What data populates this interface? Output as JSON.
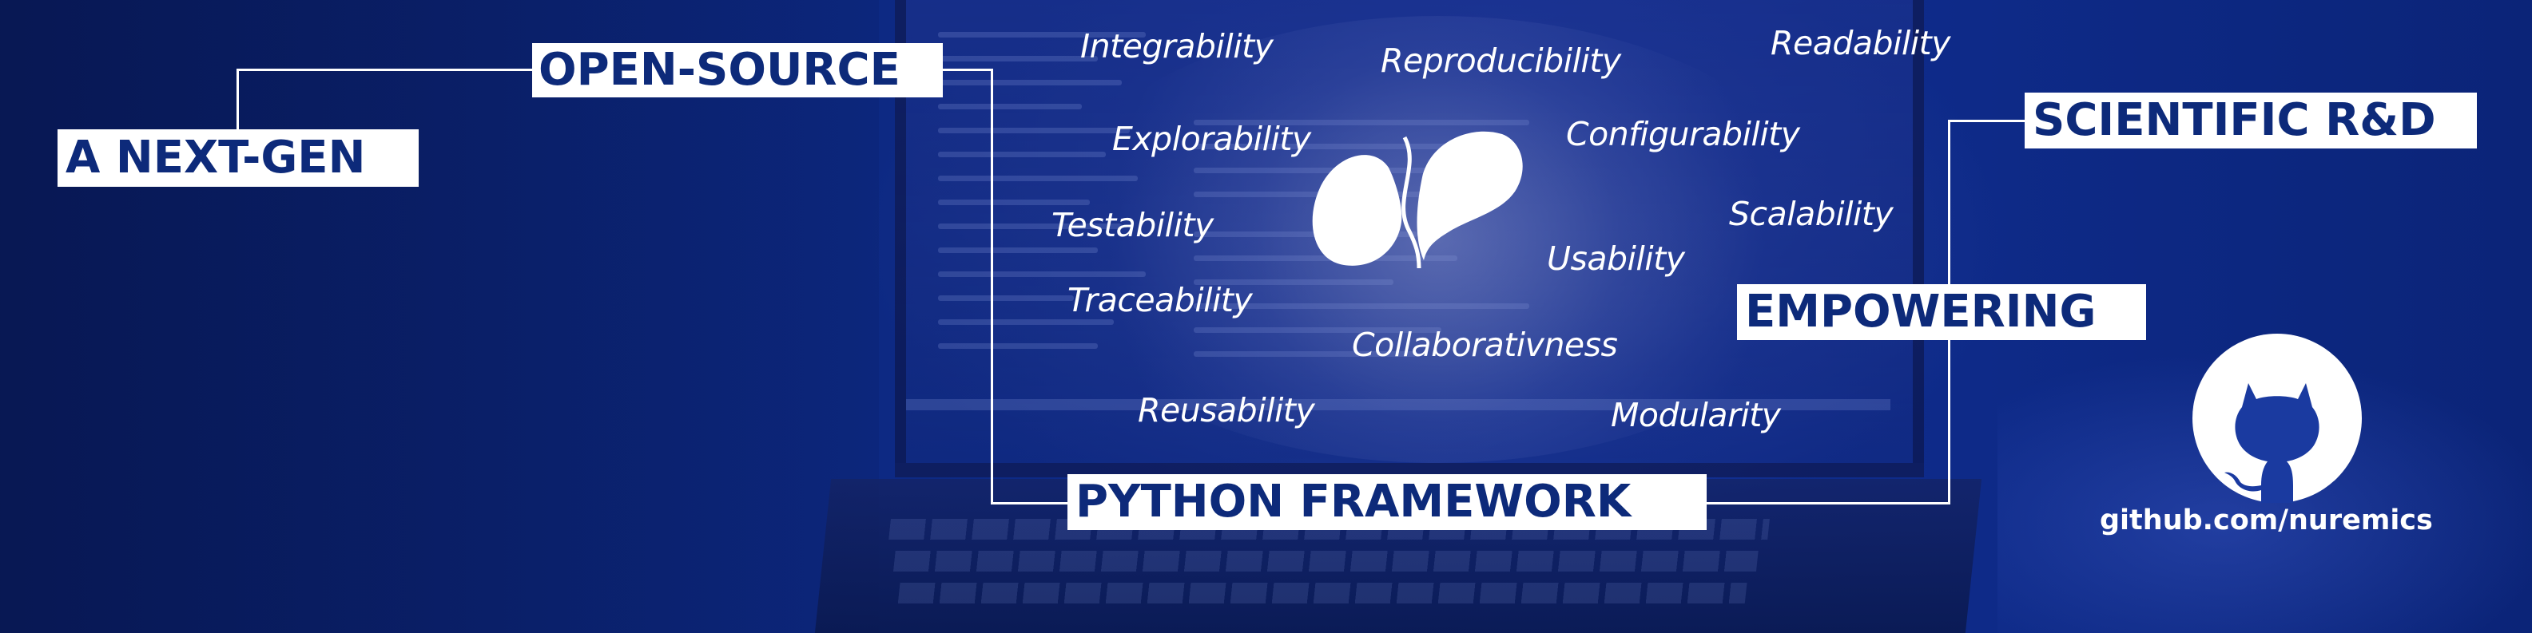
{
  "labels": {
    "next_gen": "A NEXT-GEN",
    "open_source": "OPEN-SOURCE",
    "python_framework": "PYTHON FRAMEWORK",
    "empowering": "EMPOWERING",
    "scientific_rd": "SCIENTIFIC R&D"
  },
  "qualities": [
    "Integrability",
    "Reproducibility",
    "Readability",
    "Explorability",
    "Configurability",
    "Testability",
    "Scalability",
    "Usability",
    "Traceability",
    "Collaborativness",
    "Reusability",
    "Modularity"
  ],
  "github": {
    "url_text": "github.com/nuremics",
    "icon": "github-octocat-icon"
  },
  "logo": {
    "icon": "nuremics-logo-icon"
  },
  "colors": {
    "background": "#0d2a86",
    "label_text": "#0d2a7a",
    "label_background": "#ffffff",
    "line": "#ffffff",
    "word_text": "#ffffff"
  }
}
